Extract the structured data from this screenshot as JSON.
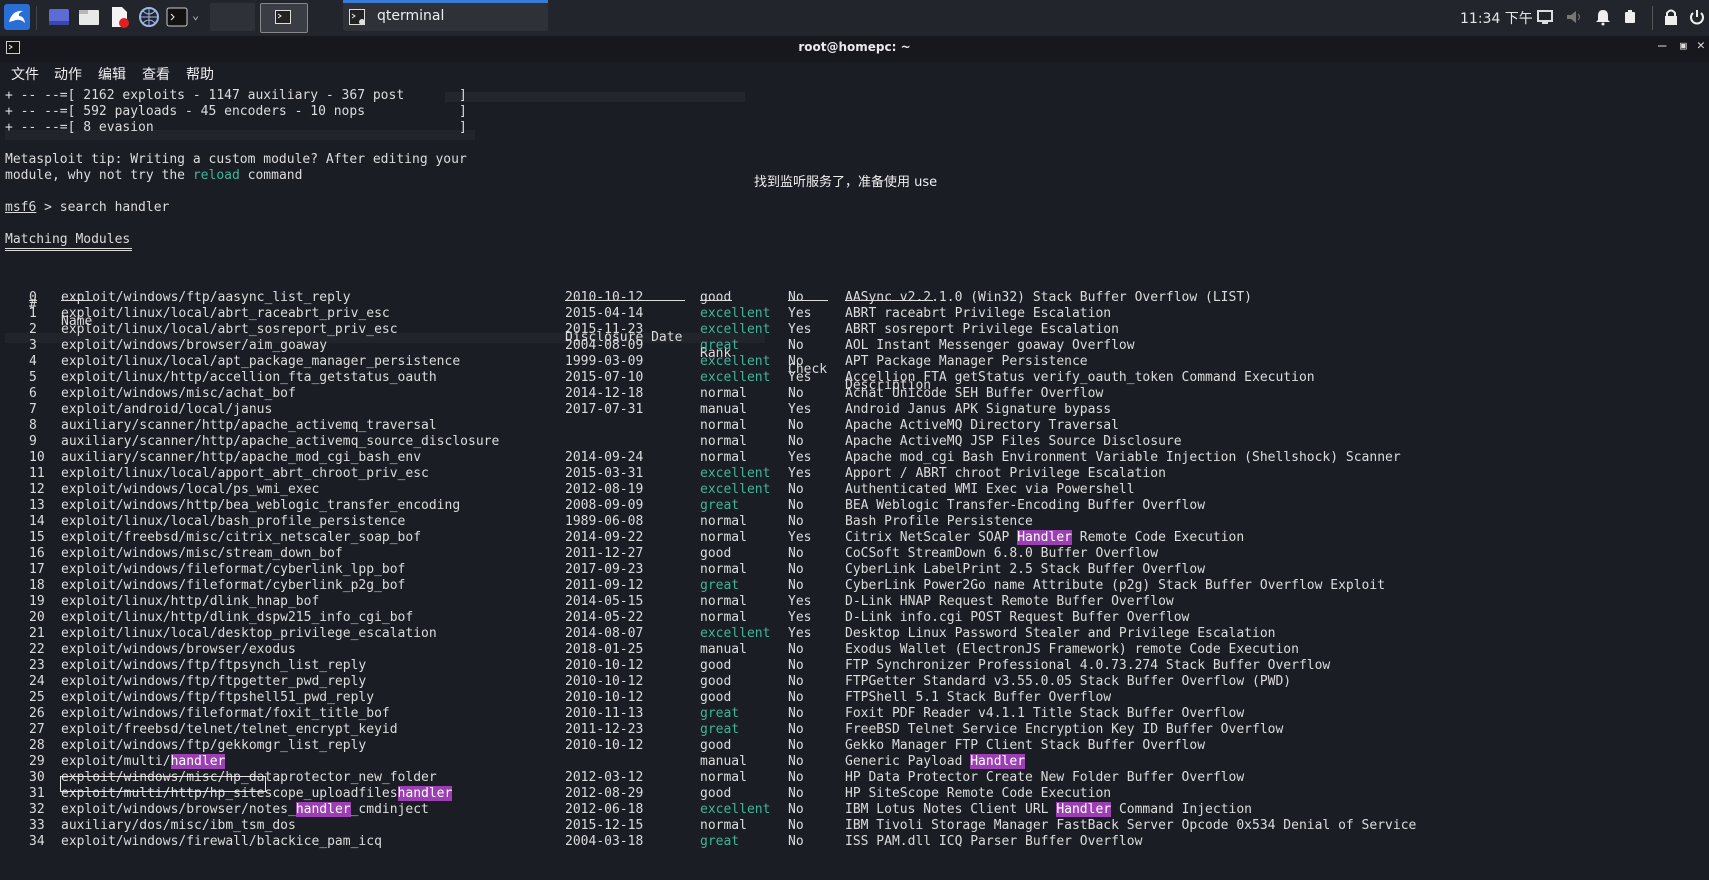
{
  "taskbar": {
    "active_app": "qterminal",
    "clock": "11:34 下午"
  },
  "window": {
    "title": "root@homepc: ~"
  },
  "menu": [
    "文件",
    "动作",
    "编辑",
    "查看",
    "帮助"
  ],
  "overlay_message": "找到监听服务了，准备使用  use",
  "banner": [
    "+ -- --=[ 2162 exploits - 1147 auxiliary - 367 post       ]",
    "+ -- --=[ 592 payloads - 45 encoders - 10 nops            ]",
    "+ -- --=[ 8 evasion                                       ]"
  ],
  "tip": {
    "line1": "Metasploit tip: Writing a custom module? After editing your",
    "line2_prefix": "module, why not try the ",
    "line2_keyword": "reload",
    "line2_suffix": " command"
  },
  "prompt": {
    "name": "msf6",
    "rest": " > search handler"
  },
  "section_title": "Matching Modules",
  "columns": {
    "num": "#",
    "name": "Name",
    "date": "Disclosure Date",
    "rank": "Rank",
    "check": "Check",
    "desc": "Description"
  },
  "rows": [
    {
      "n": "0",
      "name": "exploit/windows/ftp/aasync_list_reply",
      "date": "2010-10-12",
      "rank": "good",
      "check": "No",
      "desc": "AASync v2.2.1.0 (Win32) Stack Buffer Overflow (LIST)"
    },
    {
      "n": "1",
      "name": "exploit/linux/local/abrt_raceabrt_priv_esc",
      "date": "2015-04-14",
      "rank": "excellent",
      "check": "Yes",
      "desc": "ABRT raceabrt Privilege Escalation"
    },
    {
      "n": "2",
      "name": "exploit/linux/local/abrt_sosreport_priv_esc",
      "date": "2015-11-23",
      "rank": "excellent",
      "check": "Yes",
      "desc": "ABRT sosreport Privilege Escalation"
    },
    {
      "n": "3",
      "name": "exploit/windows/browser/aim_goaway",
      "date": "2004-08-09",
      "rank": "great",
      "check": "No",
      "desc": "AOL Instant Messenger goaway Overflow"
    },
    {
      "n": "4",
      "name": "exploit/linux/local/apt_package_manager_persistence",
      "date": "1999-03-09",
      "rank": "excellent",
      "check": "No",
      "desc": "APT Package Manager Persistence"
    },
    {
      "n": "5",
      "name": "exploit/linux/http/accellion_fta_getstatus_oauth",
      "date": "2015-07-10",
      "rank": "excellent",
      "check": "Yes",
      "desc": "Accellion FTA getStatus verify_oauth_token Command Execution"
    },
    {
      "n": "6",
      "name": "exploit/windows/misc/achat_bof",
      "date": "2014-12-18",
      "rank": "normal",
      "check": "No",
      "desc": "Achat Unicode SEH Buffer Overflow"
    },
    {
      "n": "7",
      "name": "exploit/android/local/janus",
      "date": "2017-07-31",
      "rank": "manual",
      "check": "Yes",
      "desc": "Android Janus APK Signature bypass"
    },
    {
      "n": "8",
      "name": "auxiliary/scanner/http/apache_activemq_traversal",
      "date": "",
      "rank": "normal",
      "check": "No",
      "desc": "Apache ActiveMQ Directory Traversal"
    },
    {
      "n": "9",
      "name": "auxiliary/scanner/http/apache_activemq_source_disclosure",
      "date": "",
      "rank": "normal",
      "check": "No",
      "desc": "Apache ActiveMQ JSP Files Source Disclosure"
    },
    {
      "n": "10",
      "name": "auxiliary/scanner/http/apache_mod_cgi_bash_env",
      "date": "2014-09-24",
      "rank": "normal",
      "check": "Yes",
      "desc": "Apache mod_cgi Bash Environment Variable Injection (Shellshock) Scanner"
    },
    {
      "n": "11",
      "name": "exploit/linux/local/apport_abrt_chroot_priv_esc",
      "date": "2015-03-31",
      "rank": "excellent",
      "check": "Yes",
      "desc": "Apport / ABRT chroot Privilege Escalation"
    },
    {
      "n": "12",
      "name": "exploit/windows/local/ps_wmi_exec",
      "date": "2012-08-19",
      "rank": "excellent",
      "check": "No",
      "desc": "Authenticated WMI Exec via Powershell"
    },
    {
      "n": "13",
      "name": "exploit/windows/http/bea_weblogic_transfer_encoding",
      "date": "2008-09-09",
      "rank": "great",
      "check": "No",
      "desc": "BEA Weblogic Transfer-Encoding Buffer Overflow"
    },
    {
      "n": "14",
      "name": "exploit/linux/local/bash_profile_persistence",
      "date": "1989-06-08",
      "rank": "normal",
      "check": "No",
      "desc": "Bash Profile Persistence"
    },
    {
      "n": "15",
      "name": "exploit/freebsd/misc/citrix_netscaler_soap_bof",
      "date": "2014-09-22",
      "rank": "normal",
      "check": "Yes",
      "desc": "Citrix NetScaler SOAP Handler Remote Code Execution"
    },
    {
      "n": "16",
      "name": "exploit/windows/misc/stream_down_bof",
      "date": "2011-12-27",
      "rank": "good",
      "check": "No",
      "desc": "CoCSoft StreamDown 6.8.0 Buffer Overflow"
    },
    {
      "n": "17",
      "name": "exploit/windows/fileformat/cyberlink_lpp_bof",
      "date": "2017-09-23",
      "rank": "normal",
      "check": "No",
      "desc": "CyberLink LabelPrint 2.5 Stack Buffer Overflow"
    },
    {
      "n": "18",
      "name": "exploit/windows/fileformat/cyberlink_p2g_bof",
      "date": "2011-09-12",
      "rank": "great",
      "check": "No",
      "desc": "CyberLink Power2Go name Attribute (p2g) Stack Buffer Overflow Exploit"
    },
    {
      "n": "19",
      "name": "exploit/linux/http/dlink_hnap_bof",
      "date": "2014-05-15",
      "rank": "normal",
      "check": "Yes",
      "desc": "D-Link HNAP Request Remote Buffer Overflow"
    },
    {
      "n": "20",
      "name": "exploit/linux/http/dlink_dspw215_info_cgi_bof",
      "date": "2014-05-22",
      "rank": "normal",
      "check": "Yes",
      "desc": "D-Link info.cgi POST Request Buffer Overflow"
    },
    {
      "n": "21",
      "name": "exploit/linux/local/desktop_privilege_escalation",
      "date": "2014-08-07",
      "rank": "excellent",
      "check": "Yes",
      "desc": "Desktop Linux Password Stealer and Privilege Escalation"
    },
    {
      "n": "22",
      "name": "exploit/windows/browser/exodus",
      "date": "2018-01-25",
      "rank": "manual",
      "check": "No",
      "desc": "Exodus Wallet (ElectronJS Framework) remote Code Execution"
    },
    {
      "n": "23",
      "name": "exploit/windows/ftp/ftpsynch_list_reply",
      "date": "2010-10-12",
      "rank": "good",
      "check": "No",
      "desc": "FTP Synchronizer Professional 4.0.73.274 Stack Buffer Overflow"
    },
    {
      "n": "24",
      "name": "exploit/windows/ftp/ftpgetter_pwd_reply",
      "date": "2010-10-12",
      "rank": "good",
      "check": "No",
      "desc": "FTPGetter Standard v3.55.0.05 Stack Buffer Overflow (PWD)"
    },
    {
      "n": "25",
      "name": "exploit/windows/ftp/ftpshell51_pwd_reply",
      "date": "2010-10-12",
      "rank": "good",
      "check": "No",
      "desc": "FTPShell 5.1 Stack Buffer Overflow"
    },
    {
      "n": "26",
      "name": "exploit/windows/fileformat/foxit_title_bof",
      "date": "2010-11-13",
      "rank": "great",
      "check": "No",
      "desc": "Foxit PDF Reader v4.1.1 Title Stack Buffer Overflow"
    },
    {
      "n": "27",
      "name": "exploit/freebsd/telnet/telnet_encrypt_keyid",
      "date": "2011-12-23",
      "rank": "great",
      "check": "No",
      "desc": "FreeBSD Telnet Service Encryption Key ID Buffer Overflow"
    },
    {
      "n": "28",
      "name": "exploit/windows/ftp/gekkomgr_list_reply",
      "date": "2010-10-12",
      "rank": "good",
      "check": "No",
      "desc": "Gekko Manager FTP Client Stack Buffer Overflow"
    },
    {
      "n": "29",
      "name": "exploit/multi/handler",
      "date": "",
      "rank": "manual",
      "check": "No",
      "desc": "Generic Payload Handler"
    },
    {
      "n": "30",
      "name": "exploit/windows/misc/hp_dataprotector_new_folder",
      "date": "2012-03-12",
      "rank": "normal",
      "check": "No",
      "desc": "HP Data Protector Create New Folder Buffer Overflow"
    },
    {
      "n": "31",
      "name": "exploit/multi/http/hp_sitescope_uploadfileshandler",
      "date": "2012-08-29",
      "rank": "good",
      "check": "No",
      "desc": "HP SiteScope Remote Code Execution"
    },
    {
      "n": "32",
      "name": "exploit/windows/browser/notes_handler_cmdinject",
      "date": "2012-06-18",
      "rank": "excellent",
      "check": "No",
      "desc": "IBM Lotus Notes Client URL Handler Command Injection"
    },
    {
      "n": "33",
      "name": "auxiliary/dos/misc/ibm_tsm_dos",
      "date": "2015-12-15",
      "rank": "normal",
      "check": "No",
      "desc": "IBM Tivoli Storage Manager FastBack Server Opcode 0x534 Denial of Service"
    },
    {
      "n": "34",
      "name": "exploit/windows/firewall/blackice_pam_icq",
      "date": "2004-03-18",
      "rank": "great",
      "check": "No",
      "desc": "ISS PAM.dll ICQ Parser Buffer Overflow"
    }
  ],
  "highlight_word": "handler",
  "highlight_word_cap": "Handler",
  "colors": {
    "highlight": "#9b3fb3",
    "rank_green": "#3eb49a",
    "background": "#1b1d25"
  }
}
